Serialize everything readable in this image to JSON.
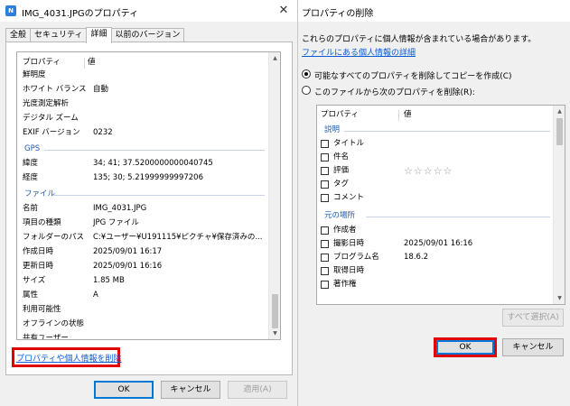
{
  "left_window": {
    "title": "IMG_4031.JPGのプロパティ",
    "icon_letter": "N",
    "tabs": [
      "全般",
      "セキュリティ",
      "詳細",
      "以前のバージョン"
    ],
    "active_tab_index": 2,
    "list_header": {
      "property": "プロパティ",
      "value": "値"
    },
    "rows_top": [
      {
        "k": "鮮明度",
        "v": ""
      },
      {
        "k": "ホワイト バランス",
        "v": "自動"
      },
      {
        "k": "光度測定解析",
        "v": ""
      },
      {
        "k": "デジタル ズーム",
        "v": ""
      },
      {
        "k": "EXIF バージョン",
        "v": "0232"
      }
    ],
    "group_gps": "GPS",
    "rows_gps": [
      {
        "k": "緯度",
        "v": "34; 41; 37.5200000000040745"
      },
      {
        "k": "経度",
        "v": "135; 30; 5.21999999997206"
      }
    ],
    "group_file": "ファイル",
    "rows_file": [
      {
        "k": "名前",
        "v": "IMG_4031.JPG"
      },
      {
        "k": "項目の種類",
        "v": "JPG ファイル"
      },
      {
        "k": "フォルダーのパス",
        "v": "C:¥ユーザー¥U191115¥ピクチャ¥保存済みの..."
      },
      {
        "k": "作成日時",
        "v": "2025/09/01 16:17"
      },
      {
        "k": "更新日時",
        "v": "2025/09/01 16:16"
      },
      {
        "k": "サイズ",
        "v": "1.85 MB"
      },
      {
        "k": "属性",
        "v": "A"
      },
      {
        "k": "利用可能性",
        "v": ""
      },
      {
        "k": "オフラインの状態",
        "v": ""
      },
      {
        "k": "共有ユーザー",
        "v": ""
      }
    ],
    "remove_link": "プロパティや個人情報を削除",
    "ok": "OK",
    "cancel": "キャンセル",
    "apply": "適用(A)"
  },
  "right_window": {
    "title": "プロパティの削除",
    "intro": "これらのプロパティに個人情報が含まれている場合があります。",
    "info_link": "ファイルにある個人情報の詳細",
    "option_copy": "可能なすべてのプロパティを削除してコピーを作成(C)",
    "option_remove": "このファイルから次のプロパティを削除(R):",
    "list_header": {
      "property": "プロパティ",
      "value": "値"
    },
    "group_description": "説明",
    "rows_description": [
      {
        "k": "タイトル",
        "v": ""
      },
      {
        "k": "件名",
        "v": ""
      },
      {
        "k": "評価",
        "v": ""
      },
      {
        "k": "タグ",
        "v": ""
      },
      {
        "k": "コメント",
        "v": ""
      }
    ],
    "rating_stars": "☆☆☆☆☆",
    "group_origin": "元の場所",
    "rows_origin": [
      {
        "k": "作成者",
        "v": ""
      },
      {
        "k": "撮影日時",
        "v": "2025/09/01 16:16"
      },
      {
        "k": "プログラム名",
        "v": "18.6.2"
      },
      {
        "k": "取得日時",
        "v": ""
      },
      {
        "k": "著作権",
        "v": ""
      }
    ],
    "select_all": "すべて選択(A)",
    "ok": "OK",
    "cancel": "キャンセル"
  },
  "close_glyph": "✕",
  "highlight_color": "#e30000",
  "accent_color": "#0078d7",
  "link_color": "#0b5bd3"
}
